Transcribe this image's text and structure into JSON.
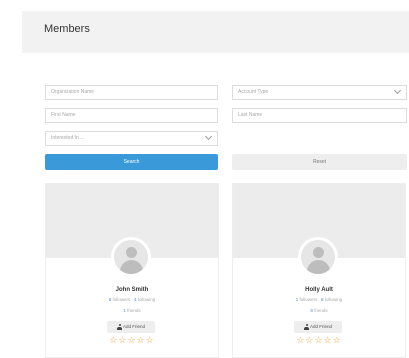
{
  "header": {
    "title": "Members"
  },
  "filters": {
    "organization_name": {
      "placeholder": "Organization Name"
    },
    "account_type": {
      "placeholder": "Account Type"
    },
    "first_name": {
      "placeholder": "First Name"
    },
    "last_name": {
      "placeholder": "Last Name"
    },
    "interested_in": {
      "placeholder": "Interested In ..."
    }
  },
  "buttons": {
    "search_label": "Search",
    "reset_label": "Reset"
  },
  "members": [
    {
      "name": "John Smith",
      "followers_count": "8",
      "followers_label": "followers",
      "following_count": "4",
      "following_label": "following",
      "friends_count": "1",
      "friends_label": "friends",
      "add_friend_label": "Add Friend",
      "stars": "☆☆☆☆☆"
    },
    {
      "name": "Holly Ault",
      "followers_count": "1",
      "followers_label": "followers",
      "following_count": "8",
      "following_label": "following",
      "friends_count": "8",
      "friends_label": "friends",
      "add_friend_label": "Add Friend",
      "stars": "☆☆☆☆☆"
    }
  ],
  "colors": {
    "primary": "#3a9ad9",
    "star": "#e8a33c",
    "link_number": "#4a90d9"
  }
}
